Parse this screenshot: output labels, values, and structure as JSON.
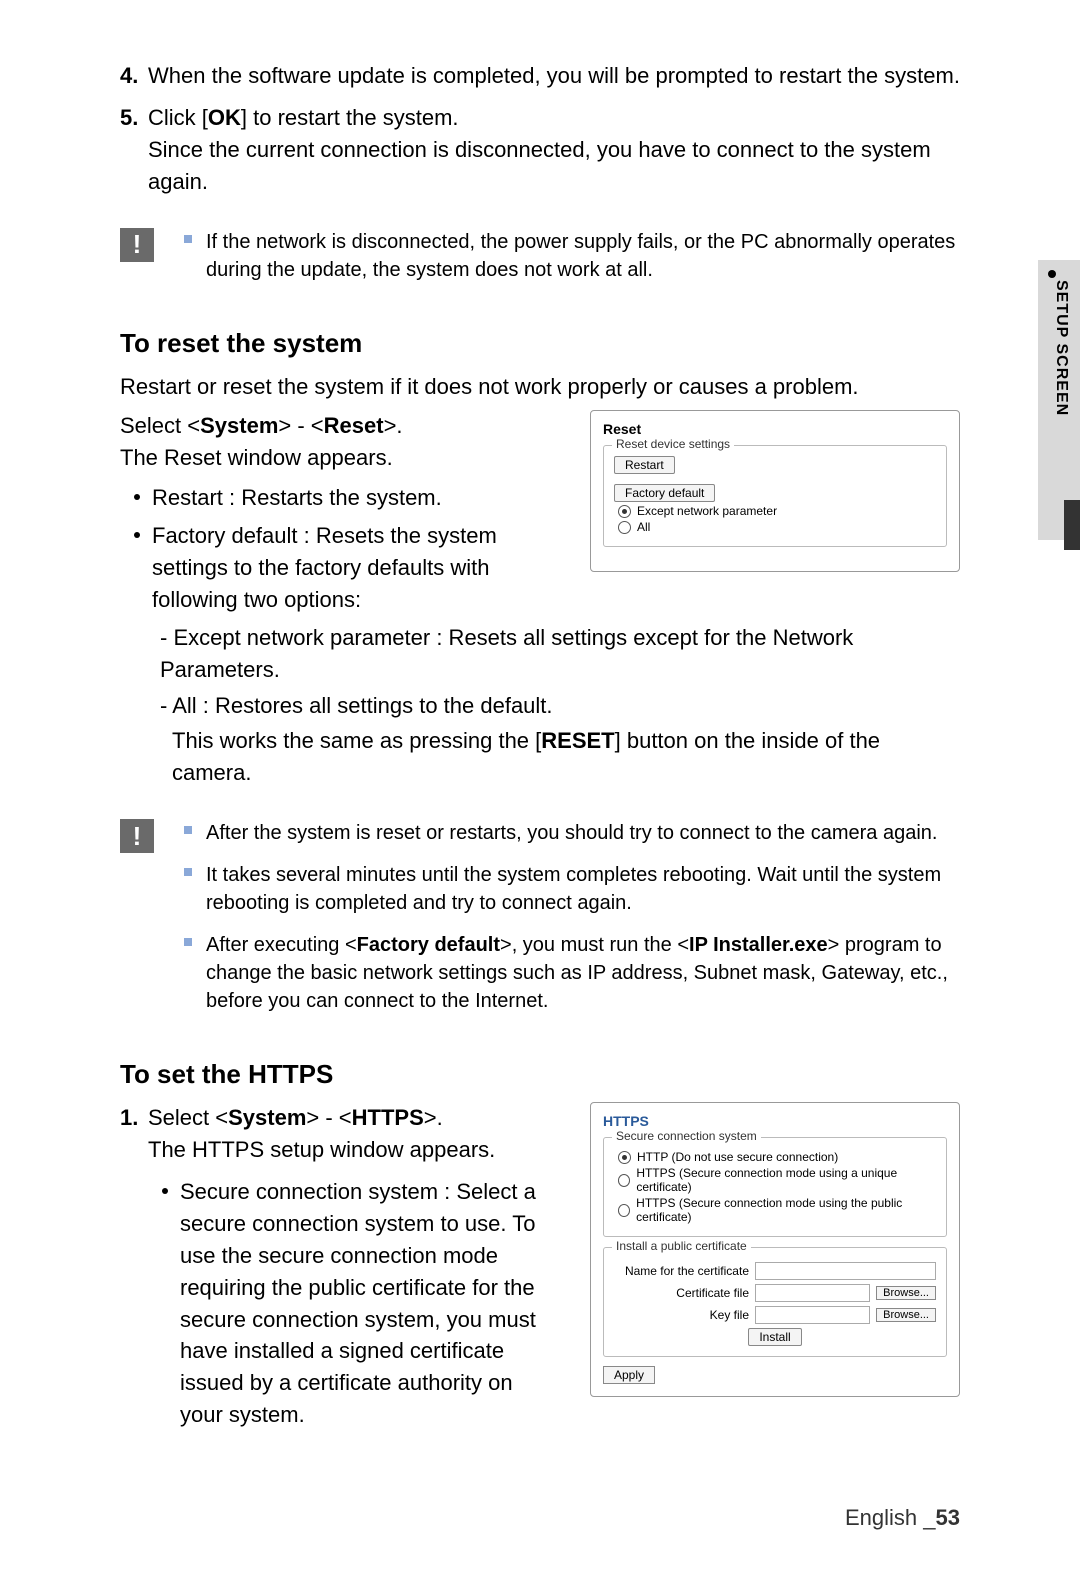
{
  "side": {
    "label": "SETUP SCREEN"
  },
  "steps": {
    "s4": {
      "num": "4.",
      "text": "When the software update is completed, you will be prompted to restart the system."
    },
    "s5": {
      "num": "5.",
      "line1a": "Click [",
      "line1b": "OK",
      "line1c": "] to restart the system.",
      "line2": "Since the current connection is disconnected, you have to connect to the system again."
    }
  },
  "notice1": {
    "i0": "If the network is disconnected, the power supply fails, or the PC abnormally operates during the update, the system does not work at all."
  },
  "reset": {
    "heading": "To reset the system",
    "intro": "Restart or reset the system if it does not work properly or causes a problem.",
    "sel_a": "Select <",
    "sel_b": "System",
    "sel_c": "> - <",
    "sel_d": "Reset",
    "sel_e": ">.",
    "appears": "The Reset window appears.",
    "b1": "Restart : Restarts the system.",
    "b2": "Factory default : Resets the system settings to the factory defaults with following two options:",
    "d1": "- Except network parameter : Resets all settings except for the Network Parameters.",
    "d2a": "- All : Restores all settings to the default.",
    "d2b_a": "This works the same as pressing the [",
    "d2b_b": "RESET",
    "d2b_c": "] button on the inside of the camera.",
    "panel": {
      "title": "Reset",
      "legend": "Reset device settings",
      "restart_btn": "Restart",
      "factory_btn": "Factory default",
      "opt_except": "Except network parameter",
      "opt_all": "All"
    }
  },
  "notice2": {
    "i0": "After the system is reset or restarts, you should try to connect to the camera again.",
    "i1": "It takes several minutes until the system completes rebooting. Wait until the system rebooting is completed and try to connect again.",
    "i2_a": "After executing <",
    "i2_b": "Factory default",
    "i2_c": ">, you must run the <",
    "i2_d": "IP Installer.exe",
    "i2_e": "> program to change the basic network settings such as IP address, Subnet mask, Gateway, etc., before you can connect to the Internet."
  },
  "https": {
    "heading": "To set the HTTPS",
    "s1_num": "1.",
    "s1_a": "Select <",
    "s1_b": "System",
    "s1_c": "> - <",
    "s1_d": "HTTPS",
    "s1_e": ">.",
    "appears": "The HTTPS setup window appears.",
    "b1": "Secure connection system : Select a secure connection system to use. To use the secure connection mode requiring the public certificate for the secure connection system, you must have installed a signed certificate issued by a certificate authority on your system.",
    "panel": {
      "title": "HTTPS",
      "legend1": "Secure connection system",
      "opt1": "HTTP   (Do not use secure connection)",
      "opt2": "HTTPS (Secure connection mode using a unique certificate)",
      "opt3": "HTTPS (Secure connection mode using the public certificate)",
      "legend2": "Install a public certificate",
      "lbl_name": "Name for the certificate",
      "lbl_cert": "Certificate file",
      "lbl_key": "Key file",
      "browse": "Browse...",
      "install": "Install",
      "apply": "Apply"
    }
  },
  "footer": {
    "lang": "English",
    "sep": " _",
    "page": "53"
  }
}
